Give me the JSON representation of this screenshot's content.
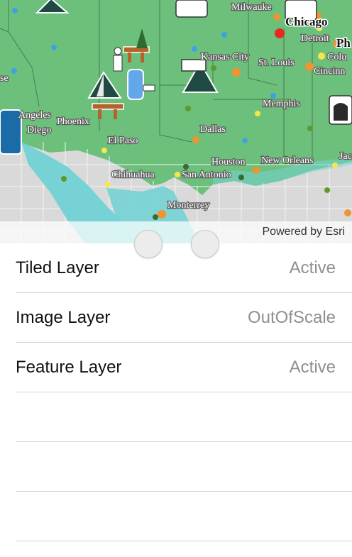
{
  "map": {
    "attribution": "Powered by Esri",
    "cities": [
      {
        "id": "milwaukee",
        "label": "Milwauke"
      },
      {
        "id": "chicago",
        "label": "Chicago"
      },
      {
        "id": "detroit",
        "label": "Detroit"
      },
      {
        "id": "philadelphia",
        "label": "Ph"
      },
      {
        "id": "kansas-city",
        "label": "Kansas City"
      },
      {
        "id": "st-louis",
        "label": "St. Louis"
      },
      {
        "id": "columbus",
        "label": "Colu"
      },
      {
        "id": "cincinnati",
        "label": "Cincinn"
      },
      {
        "id": "memphis",
        "label": "Memphis"
      },
      {
        "id": "los-angeles",
        "label": "Angeles"
      },
      {
        "id": "san-diego",
        "label": "Diego"
      },
      {
        "id": "phoenix",
        "label": "Phoenix"
      },
      {
        "id": "dallas",
        "label": "Dallas"
      },
      {
        "id": "el-paso",
        "label": "El Paso"
      },
      {
        "id": "houston",
        "label": "Houston"
      },
      {
        "id": "new-orleans",
        "label": "New Orleans"
      },
      {
        "id": "jacksonville",
        "label": "Jac"
      },
      {
        "id": "chihuahua",
        "label": "Chihuahua"
      },
      {
        "id": "san-antonio",
        "label": "San Antonio"
      },
      {
        "id": "monterrey",
        "label": "Monterrey"
      },
      {
        "id": "west-edge",
        "label": "se"
      }
    ],
    "colors": {
      "land": "#6cc07c",
      "water": "#76d2d4",
      "mexico": "#d7d7d7"
    }
  },
  "layers": [
    {
      "name": "Tiled Layer",
      "status": "Active"
    },
    {
      "name": "Image Layer",
      "status": "OutOfScale"
    },
    {
      "name": "Feature Layer",
      "status": "Active"
    }
  ],
  "empty_rows": 3
}
